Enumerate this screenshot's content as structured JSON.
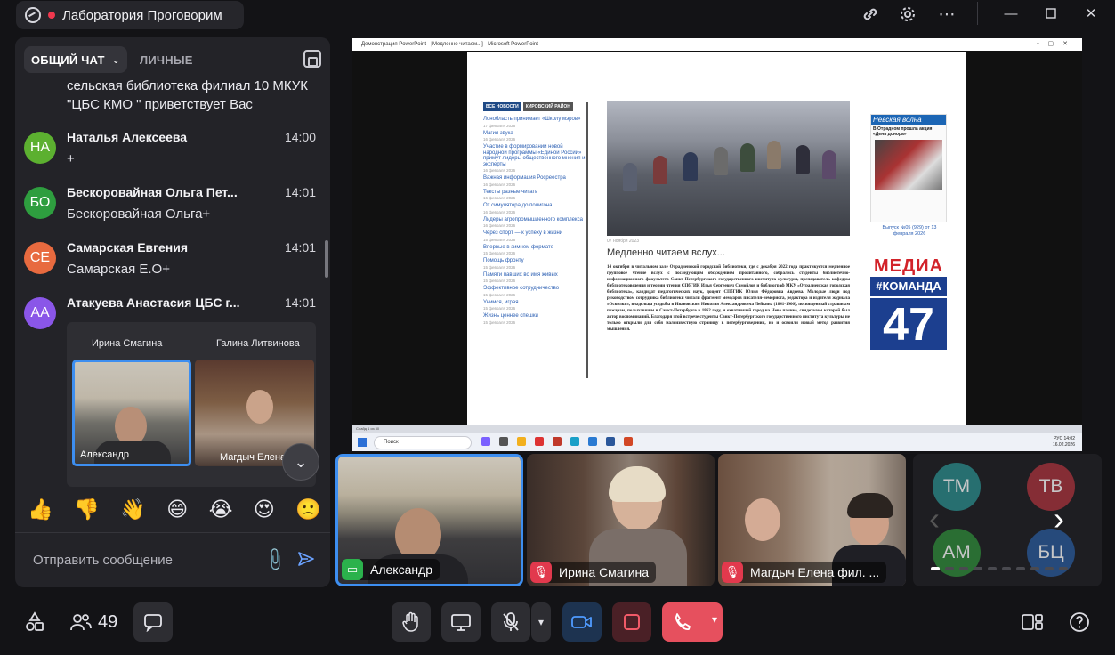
{
  "window": {
    "room_title": "Лаборатория Проговорим"
  },
  "chat": {
    "tabs": [
      {
        "label": "ОБЩИЙ ЧАТ",
        "active": true
      },
      {
        "label": "ЛИЧНЫЕ",
        "active": false
      }
    ],
    "continued_text": "сельская библиотека филиал 10 МКУК \"ЦБС КМО \" приветствует Вас",
    "messages": [
      {
        "initials": "НА",
        "name": "Наталья Алексеева",
        "time": "14:00",
        "text": "+",
        "color": "#5cb030"
      },
      {
        "initials": "БО",
        "name": "Бескоровайная Ольга Пет...",
        "time": "14:01",
        "text": "Бескоровайная Ольга+",
        "color": "#2e9e3f"
      },
      {
        "initials": "СЕ",
        "name": "Самарская Евгения",
        "time": "14:01",
        "text": "Самарская Е.О+",
        "color": "#e86a3f"
      },
      {
        "initials": "АА",
        "name": "Атакуева Анастасия ЦБС г...",
        "time": "14:01",
        "text": "",
        "color": "#8a56e8"
      }
    ],
    "shared_image": {
      "label_left": "Ирина Смагина",
      "label_right": "Галина Литвинова",
      "tile_left_name": "Александр",
      "tile_right_name": "Магдыч Елена"
    },
    "reactions": [
      "👍",
      "👎",
      "👋",
      "😄",
      "😭",
      "😍",
      "🙁"
    ],
    "input_placeholder": "Отправить сообщение"
  },
  "shared_screen": {
    "ppt_title": "Демонстрация PowerPoint - [Медленно читаем...] - Microsoft PowerPoint",
    "news_header": [
      "ВСЕ НОВОСТИ",
      "КИРОВСКИЙ РАЙОН"
    ],
    "news_items": [
      {
        "title": "Лонобласть принимает «Школу мэров»",
        "date": "17 февраля 2026"
      },
      {
        "title": "Магия звука",
        "date": "16 февраля 2026"
      },
      {
        "title": "Участие в формировании новой народной программы «Единой России» примут лидеры общественного мнения и эксперты",
        "date": "16 февраля 2026"
      },
      {
        "title": "Важная информация Росреестра",
        "date": "16 февраля 2026"
      },
      {
        "title": "Тексты разные читать",
        "date": "16 февраля 2026"
      },
      {
        "title": "От симулятора до полигона!",
        "date": "16 февраля 2026"
      },
      {
        "title": "Лидеры агропромышленного комплекса",
        "date": "16 февраля 2026"
      },
      {
        "title": "Через спорт — к успеху в жизни",
        "date": "15 февраля 2026"
      },
      {
        "title": "Впервые в зимнем формате",
        "date": "15 февраля 2026"
      },
      {
        "title": "Помощь фронту",
        "date": "15 февраля 2026"
      },
      {
        "title": "Памяти павших во имя живых",
        "date": "15 февраля 2026"
      },
      {
        "title": "Эффективное сотрудничество",
        "date": "15 февраля 2026"
      },
      {
        "title": "Учимся, играя",
        "date": "15 февраля 2026"
      },
      {
        "title": "Жизнь ценнее спешки",
        "date": "15 февраля 2026"
      }
    ],
    "article": {
      "date": "07 ноября 2023",
      "title": "Медленно читаем вслух...",
      "body": "14 октября в читальном зале Отрадненской городской библиотеки, где с декабря 2022 года практикуется медленное групповое чтение вслух с последующим обсуждением прочитанного, собрались студенты библиотечно-информационного факультета Санкт-Петербургского государственного института культуры, преподаватель кафедры библиотековедения и теории чтения СПбГИК Илья Сергеевич Самойлов и библиограф МКУ «Отрадненская городская библиотека», кандидат педагогических наук, доцент СПбГИК Юлия Фёдоровна Авдеева. Молодые люди под руководством сотрудника библиотеки читали фрагмент мемуаров писателя-немориста, редактора и издателя журнала «Осколки», владельца усадьбы в Ивановском Николая Александровича Лейкина (1841-1906), посвященный страшным пожарам, полыхавшим в Санкт-Петербурге в 1862 году, и охватившей город на Неве панике, свидетелем которой был автор воспоминаний. Благодаря этой встрече студенты Санкт-Петербургского государственного института культуры не только открыли для себя малоизвестную страницу в петербурговедении, но и освоили новый метод развития мышления."
    },
    "newspaper": {
      "name": "Невская волна",
      "headline": "В Отрадном прошла акция «День донора»",
      "issue": "Выпуск №05 (929) от 13 февраля 2026"
    },
    "media_ad": {
      "line1": "МЕДИА",
      "line2": "#КОМАНДА",
      "line3": "47"
    },
    "status_text": "Слайд 1 из 30",
    "taskbar_search": "Поиск",
    "taskbar_lang": "РУС",
    "taskbar_time": "14:02",
    "taskbar_date": "16.02.2026"
  },
  "participants": [
    {
      "name": "Александр",
      "status": "screen-share",
      "active": true
    },
    {
      "name": "Ирина Смагина",
      "status": "muted",
      "active": false
    },
    {
      "name": "Магдыч Елена фил. ...",
      "status": "muted",
      "active": false
    }
  ],
  "mini_avatars": [
    {
      "initials": "ТМ",
      "color": "#2a8a8a"
    },
    {
      "initials": "ТВ",
      "color": "#a8323c"
    },
    {
      "initials": "АМ",
      "color": "#2f8a3a"
    },
    {
      "initials": "БЦ",
      "color": "#2a5a9a"
    }
  ],
  "toolbar": {
    "participants_count": "49"
  }
}
